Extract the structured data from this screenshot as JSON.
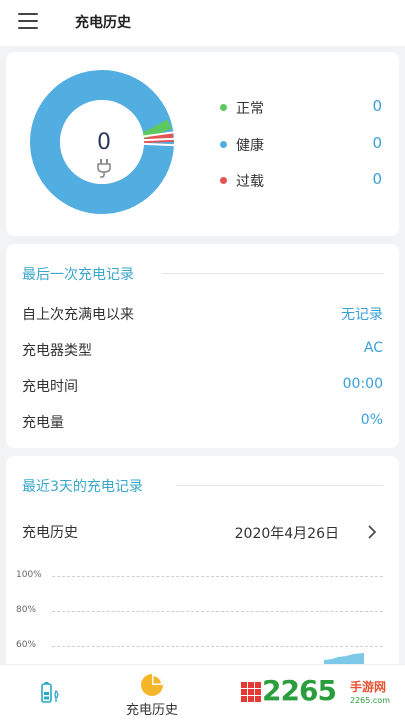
{
  "header": {
    "title": "充电历史"
  },
  "summary": {
    "count": "0",
    "legend": [
      {
        "label": "正常",
        "value": "0",
        "color": "#5cc85f"
      },
      {
        "label": "健康",
        "value": "0",
        "color": "#52ade0"
      },
      {
        "label": "过载",
        "value": "0",
        "color": "#e25555"
      }
    ]
  },
  "last_charge": {
    "title": "最后一次充电记录",
    "rows": [
      {
        "label": "自上次充满电以来",
        "value": "无记录"
      },
      {
        "label": "充电器类型",
        "value": "AC"
      },
      {
        "label": "充电时间",
        "value": "00:00"
      },
      {
        "label": "充电量",
        "value": "0%"
      }
    ]
  },
  "recent": {
    "title": "最近3天的充电记录",
    "history_label": "充电历史",
    "date": "2020年4月26日",
    "ticks": [
      "100%",
      "80%",
      "60%"
    ]
  },
  "bottom_nav": [
    {
      "label": "",
      "icon": "battery-icon"
    },
    {
      "label": "充电历史",
      "icon": "pie-chart-icon"
    },
    {
      "label": "",
      "icon": "grid-icon"
    }
  ],
  "watermark": {
    "text": "2265",
    "sub": "手游网",
    "url": "2265.com"
  },
  "colors": {
    "accent": "#3aa0d9",
    "section": "#38a7c9",
    "donut_main": "#52ade0"
  }
}
